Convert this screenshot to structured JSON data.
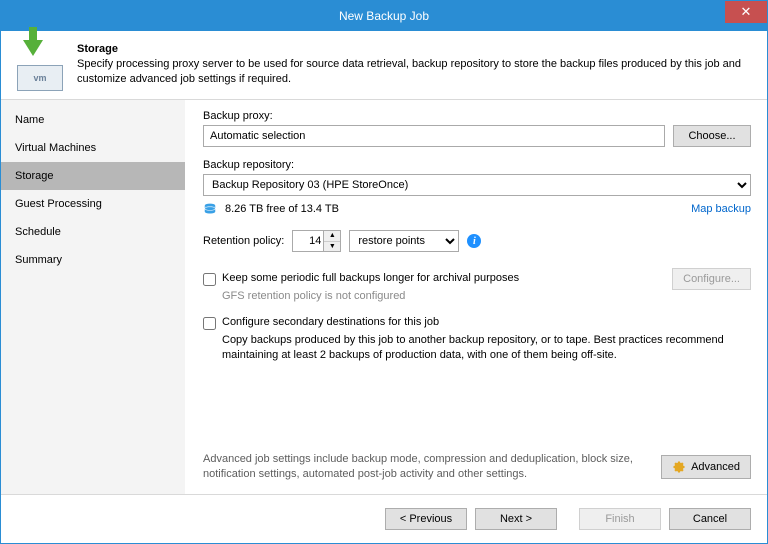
{
  "title": "New Backup Job",
  "header": {
    "title": "Storage",
    "desc": "Specify processing proxy server to be used for source data retrieval, backup repository to store the backup files produced by this job and customize advanced job settings if required.",
    "vm_label": "vm"
  },
  "sidebar": {
    "items": [
      {
        "label": "Name"
      },
      {
        "label": "Virtual Machines"
      },
      {
        "label": "Storage"
      },
      {
        "label": "Guest Processing"
      },
      {
        "label": "Schedule"
      },
      {
        "label": "Summary"
      }
    ],
    "selected_index": 2
  },
  "main": {
    "proxy_label": "Backup proxy:",
    "proxy_value": "Automatic selection",
    "choose_label": "Choose...",
    "repo_label": "Backup repository:",
    "repo_value": "Backup Repository 03 (HPE StoreOnce)",
    "free_space": "8.26 TB free of 13.4 TB",
    "map_backup": "Map backup",
    "retention_label": "Retention policy:",
    "retention_value": "14",
    "retention_unit": "restore points",
    "keep_full_label": "Keep some periodic full backups longer for archival purposes",
    "configure_label": "Configure...",
    "gfs_note": "GFS retention policy is not configured",
    "secondary_label": "Configure secondary destinations for this job",
    "secondary_desc": "Copy backups produced by this job to another backup repository, or to tape. Best practices recommend maintaining at least 2 backups of production data, with one of them being off-site.",
    "advanced_desc": "Advanced job settings include backup mode, compression and deduplication, block size, notification settings, automated post-job activity and other settings.",
    "advanced_label": "Advanced"
  },
  "footer": {
    "previous": "< Previous",
    "next": "Next >",
    "finish": "Finish",
    "cancel": "Cancel"
  }
}
